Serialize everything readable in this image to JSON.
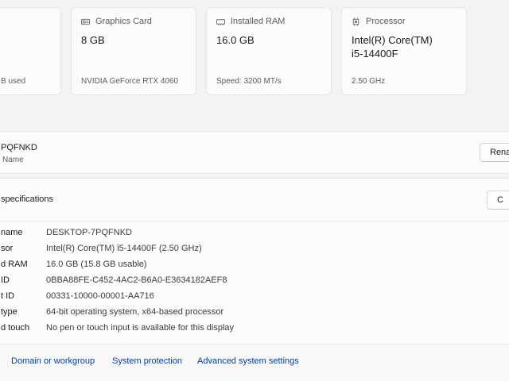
{
  "cards": [
    {
      "title": "",
      "value": "",
      "sub": "B used",
      "icon": "storage-icon"
    },
    {
      "title": "Graphics Card",
      "value": "8 GB",
      "sub": "NVIDIA GeForce RTX 4060",
      "icon": "graphics-card-icon"
    },
    {
      "title": "Installed RAM",
      "value": "16.0 GB",
      "sub": "Speed: 3200 MT/s",
      "icon": "ram-icon"
    },
    {
      "title": "Processor",
      "value_line1": "Intel(R) Core(TM)",
      "value_line2": "i5-14400F",
      "sub": "2.50 GHz",
      "icon": "processor-icon"
    }
  ],
  "device": {
    "name": "PQFNKD",
    "label": "Name",
    "rename_label": "Rena"
  },
  "specs": {
    "title": "specifications",
    "copy_label": "C",
    "rows": [
      {
        "label": "name",
        "value": "DESKTOP-7PQFNKD"
      },
      {
        "label": "sor",
        "value": "Intel(R) Core(TM) i5-14400F (2.50 GHz)"
      },
      {
        "label": "d RAM",
        "value": "16.0 GB (15.8 GB usable)"
      },
      {
        "label": "ID",
        "value": "0BBA88FE-C452-4AC2-B6A0-E3634182AEF8"
      },
      {
        "label": "t ID",
        "value": "00331-10000-00001-AA716"
      },
      {
        "label": "type",
        "value": "64-bit operating system, x64-based processor"
      },
      {
        "label": "d touch",
        "value": "No pen or touch input is available for this display"
      }
    ]
  },
  "related_links": [
    {
      "label": "Domain or workgroup"
    },
    {
      "label": "System protection"
    },
    {
      "label": "Advanced system settings"
    }
  ],
  "colors": {
    "background": "#f3f3f3",
    "card": "#fbfbfb",
    "link": "#003e92"
  }
}
